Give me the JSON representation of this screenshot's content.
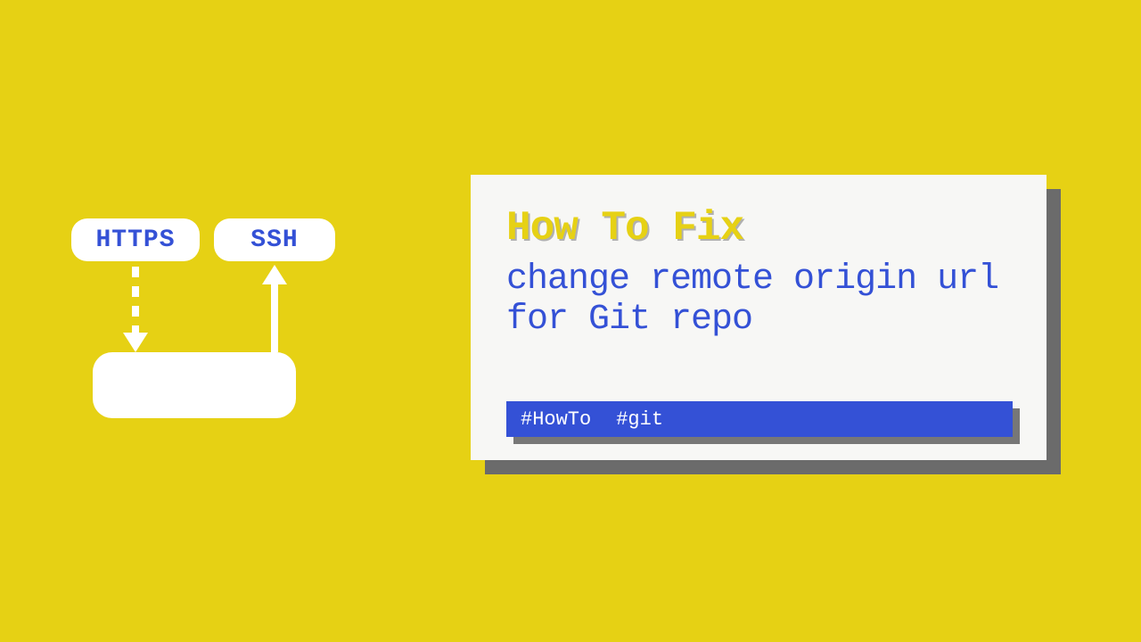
{
  "diagram": {
    "node_https": "HTTPS",
    "node_ssh": "SSH",
    "node_bottom": ""
  },
  "card": {
    "title": "How To Fix",
    "subtitle": "change remote origin url for Git repo",
    "tags": [
      "#HowTo",
      "#git"
    ]
  },
  "colors": {
    "background": "#e6d114",
    "accent_blue": "#3451d6",
    "white": "#ffffff",
    "card_bg": "#f7f7f5",
    "shadow": "#6b6b6b"
  }
}
